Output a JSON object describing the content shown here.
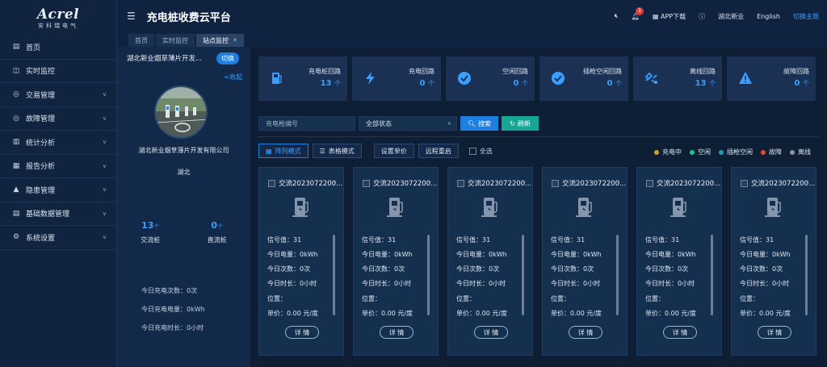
{
  "logo": {
    "name": "Acrel",
    "sub": "安科瑞电气"
  },
  "sidebar": {
    "items": [
      {
        "label": "首页",
        "icon": "home-icon",
        "glyph": "▤"
      },
      {
        "label": "实时监控",
        "icon": "monitor-icon",
        "glyph": "◫"
      },
      {
        "label": "交易管理",
        "icon": "trade-icon",
        "glyph": "◎"
      },
      {
        "label": "故障管理",
        "icon": "fault-icon",
        "glyph": "◎"
      },
      {
        "label": "统计分析",
        "icon": "stats-icon",
        "glyph": "▥"
      },
      {
        "label": "报告分析",
        "icon": "report-icon",
        "glyph": "▦"
      },
      {
        "label": "隐患管理",
        "icon": "warning-icon",
        "glyph": "▲"
      },
      {
        "label": "基础数据管理",
        "icon": "data-icon",
        "glyph": "▤"
      },
      {
        "label": "系统设置",
        "icon": "settings-icon",
        "glyph": "⚙"
      }
    ]
  },
  "header": {
    "title": "充电桩收费云平台",
    "bell_count": "3",
    "app_download": "APP下载",
    "user": "湖北新业",
    "lang": "English",
    "switch_home": "切换主题"
  },
  "tabs": [
    {
      "label": "首页"
    },
    {
      "label": "实时监控"
    },
    {
      "label": "站点监控",
      "active": true
    }
  ],
  "station": {
    "name": "湖北新业烟草薄片开发...",
    "switch_label": "切换",
    "collapse_label": "<收起",
    "company": "湖北新业烟草薄片开发有限公司",
    "region": "湖北",
    "ac_count": "13",
    "ac_unit": "个",
    "ac_label": "交流桩",
    "dc_count": "0",
    "dc_unit": "个",
    "dc_label": "直流桩",
    "today_times": "今日充电次数：0次",
    "today_energy": "今日充电电量：0kWh",
    "today_duration": "今日充电时长：0小时"
  },
  "stats": [
    {
      "label": "充电桩回路",
      "value": "13",
      "unit": "个",
      "icon": "charger-icon"
    },
    {
      "label": "充电回路",
      "value": "0",
      "unit": "个",
      "icon": "bolt-icon"
    },
    {
      "label": "空闲回路",
      "value": "0",
      "unit": "个",
      "icon": "check-circle-icon"
    },
    {
      "label": "插枪空闲回路",
      "value": "0",
      "unit": "个",
      "icon": "check-circle-icon"
    },
    {
      "label": "离线回路",
      "value": "13",
      "unit": "个",
      "icon": "unplug-icon"
    },
    {
      "label": "故障回路",
      "value": "0",
      "unit": "个",
      "icon": "alert-icon"
    }
  ],
  "filters": {
    "code_placeholder": "充电枪编号",
    "status_value": "全部状态",
    "search_label": "搜索",
    "refresh_label": "刷新"
  },
  "toolbar": {
    "grid_mode": "阵列模式",
    "table_mode": "表格模式",
    "set_price": "设置单价",
    "remote_restart": "远程重启",
    "select_all": "全选"
  },
  "legend": [
    {
      "label": "充电中",
      "color": "#c9a227"
    },
    {
      "label": "空闲",
      "color": "#1fc48f"
    },
    {
      "label": "插枪空闲",
      "color": "#1a9fb5"
    },
    {
      "label": "故障",
      "color": "#e2492f"
    },
    {
      "label": "离线",
      "color": "#8a96a6"
    }
  ],
  "cards": [
    {
      "title": "交流2023072200...",
      "signal": "信号值：31",
      "energy": "今日电量：0kWh",
      "count": "今日次数：0次",
      "duration": "今日时长：0小时",
      "location": "位置：",
      "price": "单价：0.00 元/度",
      "detail": "详 情"
    },
    {
      "title": "交流2023072200...",
      "signal": "信号值：31",
      "energy": "今日电量：0kWh",
      "count": "今日次数：0次",
      "duration": "今日时长：0小时",
      "location": "位置：",
      "price": "单价：0.00 元/度",
      "detail": "详 情"
    },
    {
      "title": "交流2023072200...",
      "signal": "信号值：31",
      "energy": "今日电量：0kWh",
      "count": "今日次数：0次",
      "duration": "今日时长：0小时",
      "location": "位置：",
      "price": "单价：0.00 元/度",
      "detail": "详 情"
    },
    {
      "title": "交流2023072200...",
      "signal": "信号值：31",
      "energy": "今日电量：0kWh",
      "count": "今日次数：0次",
      "duration": "今日时长：0小时",
      "location": "位置：",
      "price": "单价：0.00 元/度",
      "detail": "详 情"
    },
    {
      "title": "交流2023072200...",
      "signal": "信号值：31",
      "energy": "今日电量：0kWh",
      "count": "今日次数：0次",
      "duration": "今日时长：0小时",
      "location": "位置：",
      "price": "单价：0.00 元/度",
      "detail": "详 情"
    },
    {
      "title": "交流2023072200...",
      "signal": "信号值：31",
      "energy": "今日电量：0kWh",
      "count": "今日次数：0次",
      "duration": "今日时长：0小时",
      "location": "位置：",
      "price": "单价：0.00 元/度",
      "detail": "详 情"
    }
  ],
  "colors": {
    "accent": "#1e7fe0",
    "value_blue": "#3aa0ff",
    "teal": "#17a596"
  }
}
